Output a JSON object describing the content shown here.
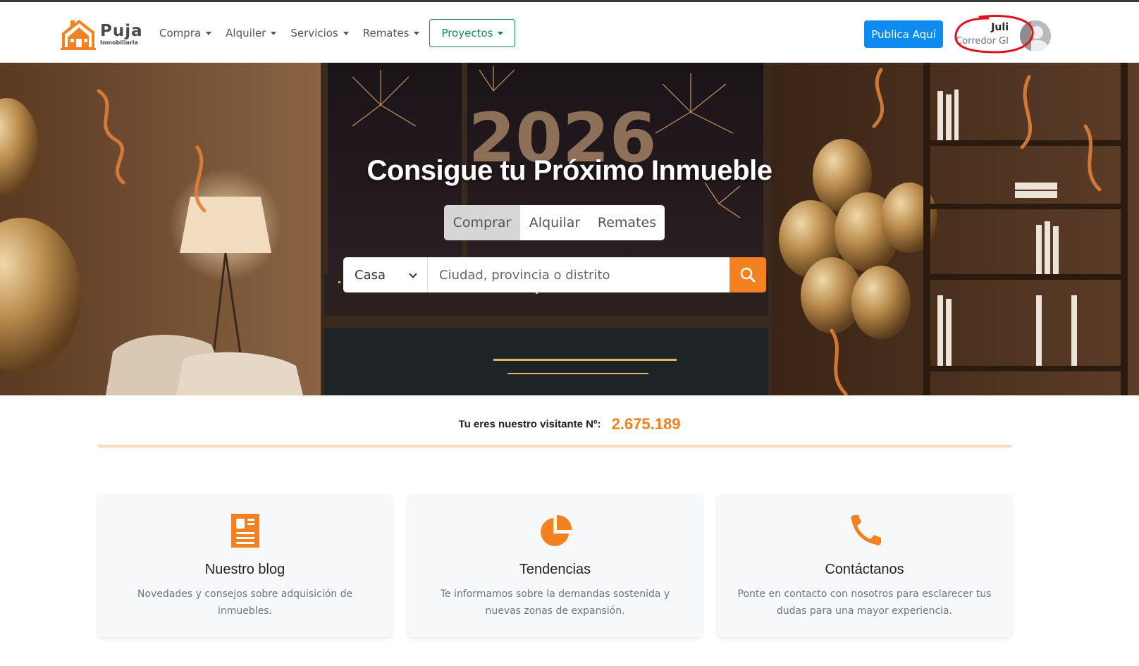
{
  "brand": {
    "name": "Puja",
    "subtitle": "Inmobiliaria"
  },
  "nav": {
    "items": [
      {
        "label": "Compra"
      },
      {
        "label": "Alquiler"
      },
      {
        "label": "Servicios"
      },
      {
        "label": "Remates"
      },
      {
        "label": "Proyectos"
      }
    ],
    "publish_label": "Publica Aquí"
  },
  "user": {
    "name": "Juli",
    "role": "Corredor GI"
  },
  "hero": {
    "title": "Consigue tu Próximo Inmueble",
    "tabs": [
      {
        "label": "Comprar",
        "active": true
      },
      {
        "label": "Alquilar",
        "active": false
      },
      {
        "label": "Remates",
        "active": false
      }
    ],
    "property_type": "Casa",
    "search_placeholder": "Ciudad, provincia o distrito"
  },
  "visitor": {
    "label": "Tu eres nuestro visitante Nº:",
    "count": "2.675.189"
  },
  "cards": [
    {
      "icon": "blog-document-icon",
      "title": "Nuestro blog",
      "text": "Novedades y consejos sobre adquisición de inmuebles."
    },
    {
      "icon": "pie-chart-icon",
      "title": "Tendencias",
      "text": "Te informamos sobre la demandas sostenida y nuevas zonas de expansión."
    },
    {
      "icon": "phone-icon",
      "title": "Contáctanos",
      "text": "Ponte en contacto con nosotros para esclarecer tus dudas para una mayor experiencia."
    }
  ],
  "colors": {
    "accent": "#f48120",
    "primary": "#0d8bf0",
    "success": "#198754",
    "annotation": "#e0101e"
  }
}
